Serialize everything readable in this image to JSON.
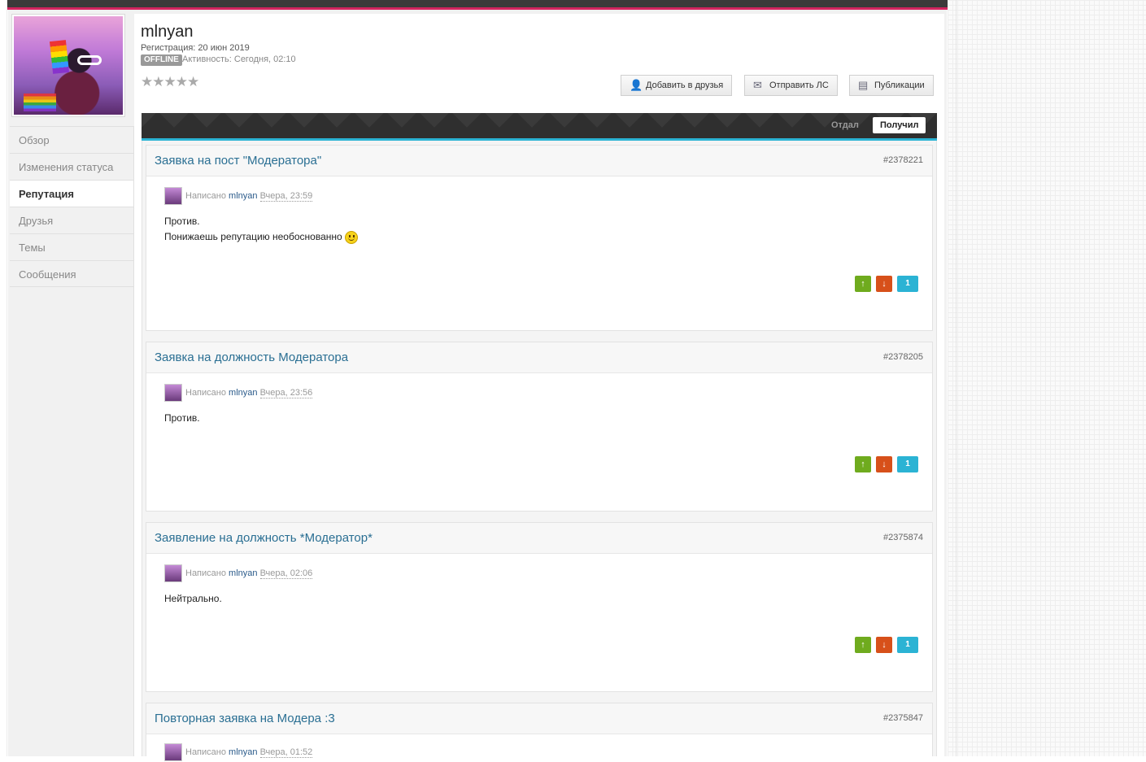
{
  "profile": {
    "username": "mlnyan",
    "registration": "Регистрация: 20 июн 2019",
    "status": "OFFLINE",
    "activity": "Активность: Сегодня, 02:10",
    "rating_stars": 5
  },
  "actions": {
    "add_friend": "Добавить в друзья",
    "send_pm": "Отправить ЛС",
    "publications": "Публикации"
  },
  "sidebar": {
    "items": [
      {
        "label": "Обзор",
        "active": false
      },
      {
        "label": "Изменения статуса",
        "active": false
      },
      {
        "label": "Репутация",
        "active": true
      },
      {
        "label": "Друзья",
        "active": false
      },
      {
        "label": "Темы",
        "active": false
      },
      {
        "label": "Сообщения",
        "active": false
      }
    ]
  },
  "tabs": {
    "given": "Отдал",
    "received": "Получил"
  },
  "posts": [
    {
      "title": "Заявка на пост \"Модератора\"",
      "id": "#2378221",
      "written": "Написано",
      "author": "mlnyan",
      "date": "Вчера, 23:59",
      "body_line1": "Против.",
      "body_line2": "Понижаешь репутацию необоснованно",
      "rep": "1"
    },
    {
      "title": "Заявка на должность Модератора",
      "id": "#2378205",
      "written": "Написано",
      "author": "mlnyan",
      "date": "Вчера, 23:56",
      "body_line1": "Против.",
      "rep": "1"
    },
    {
      "title": "Заявление на должность *Модератор*",
      "id": "#2375874",
      "written": "Написано",
      "author": "mlnyan",
      "date": "Вчера, 02:06",
      "body_line1": "Нейтрально.",
      "rep": "1"
    },
    {
      "title": "Повторная заявка на Модера :3",
      "id": "#2375847",
      "written": "Написано",
      "author": "mlnyan",
      "date": "Вчера, 01:52"
    }
  ],
  "icons": {
    "add_friend": "add-user-icon",
    "send_pm": "envelope-icon",
    "publications": "document-icon",
    "rep_up": "arrow-up-icon",
    "rep_down": "arrow-down-icon",
    "smile": "smile-emoticon-icon"
  },
  "colors": {
    "accent_top": "#d2245f",
    "tab_accent": "#2bb3d4",
    "link": "#2a6f93",
    "rep_up": "#6fab1e",
    "rep_down": "#d7501a",
    "rep_count": "#2bb3d4"
  }
}
